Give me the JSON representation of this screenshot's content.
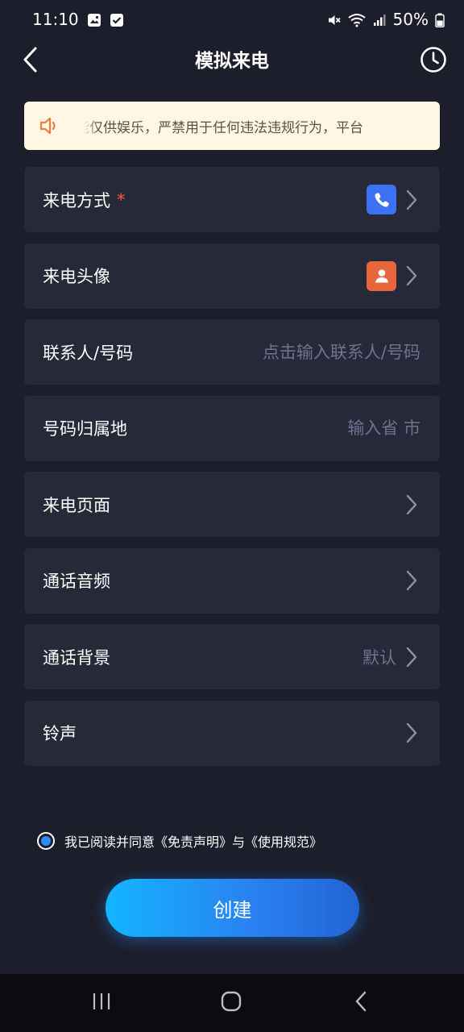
{
  "status_bar": {
    "time": "11:10",
    "battery": "50%"
  },
  "header": {
    "title": "模拟来电"
  },
  "notice": {
    "text": "能仅供娱乐，严禁用于任何违法违规行为，平台"
  },
  "rows": {
    "call_method": {
      "label": "来电方式",
      "required": "*"
    },
    "avatar": {
      "label": "来电头像"
    },
    "contact": {
      "label": "联系人/号码",
      "placeholder": "点击输入联系人/号码"
    },
    "location": {
      "label": "号码归属地",
      "placeholder": "输入省 市"
    },
    "call_page": {
      "label": "来电页面"
    },
    "call_audio": {
      "label": "通话音频"
    },
    "call_background": {
      "label": "通话背景",
      "value": "默认"
    },
    "ringtone": {
      "label": "铃声"
    }
  },
  "agreement": {
    "prefix": "我已阅读并同意",
    "disclaimer_link": "《免责声明》",
    "conjunction": "与",
    "terms_link": "《使用规范》"
  },
  "create_button": {
    "label": "创建"
  },
  "icons": {
    "back": "chevron-left-icon",
    "history": "clock-icon",
    "notice": "speaker-icon",
    "call_method": "phone-icon",
    "avatar": "person-icon"
  },
  "colors": {
    "background": "#1d1e2b",
    "row_background": "#272938",
    "notice_background": "#fff6e3",
    "required": "#ff5a35",
    "accent_blue": "#3b71f2",
    "accent_orange": "#e8663b",
    "muted_text": "#6f7291"
  }
}
